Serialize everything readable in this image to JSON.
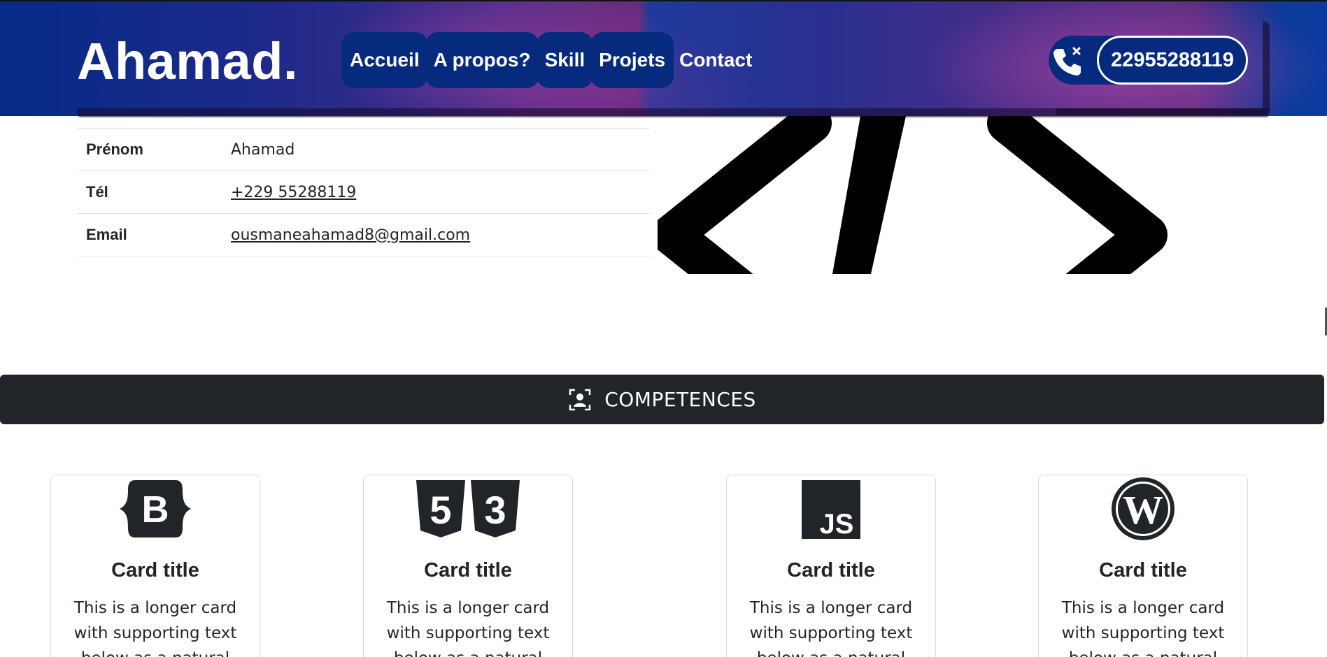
{
  "header": {
    "brand": "Ahamad.",
    "nav": [
      "Accueil",
      "A propos?",
      "Skill",
      "Projets",
      "Contact"
    ],
    "phone_number": "22955288119",
    "phone_icon": "phone-x-icon"
  },
  "info": {
    "rows": [
      {
        "key": "Prénom",
        "value": "Ahamad"
      },
      {
        "key": "Tél",
        "value": "+229 55288119"
      },
      {
        "key": "Email",
        "value": "ousmaneahamad8@gmail.com"
      }
    ]
  },
  "hero_icon": "code-slash-icon",
  "competences": {
    "title": "COMPETENCES",
    "icon": "person-badge-icon"
  },
  "cards": [
    {
      "icon": "bootstrap-icon",
      "title": "Card title",
      "text": "This is a longer card with supporting text below as a natural"
    },
    {
      "icon": "css3-icon",
      "title": "Card title",
      "text": "This is a longer card with supporting text below as a natural"
    },
    {
      "icon": "javascript-icon",
      "title": "Card title",
      "text": "This is a longer card with supporting text below as a natural"
    },
    {
      "icon": "wordpress-icon",
      "title": "Card title",
      "text": "This is a longer card with supporting text below as a natural"
    }
  ],
  "colors": {
    "nav_bg": "#062a7e",
    "dark_bar": "#212529",
    "text": "#212529"
  }
}
